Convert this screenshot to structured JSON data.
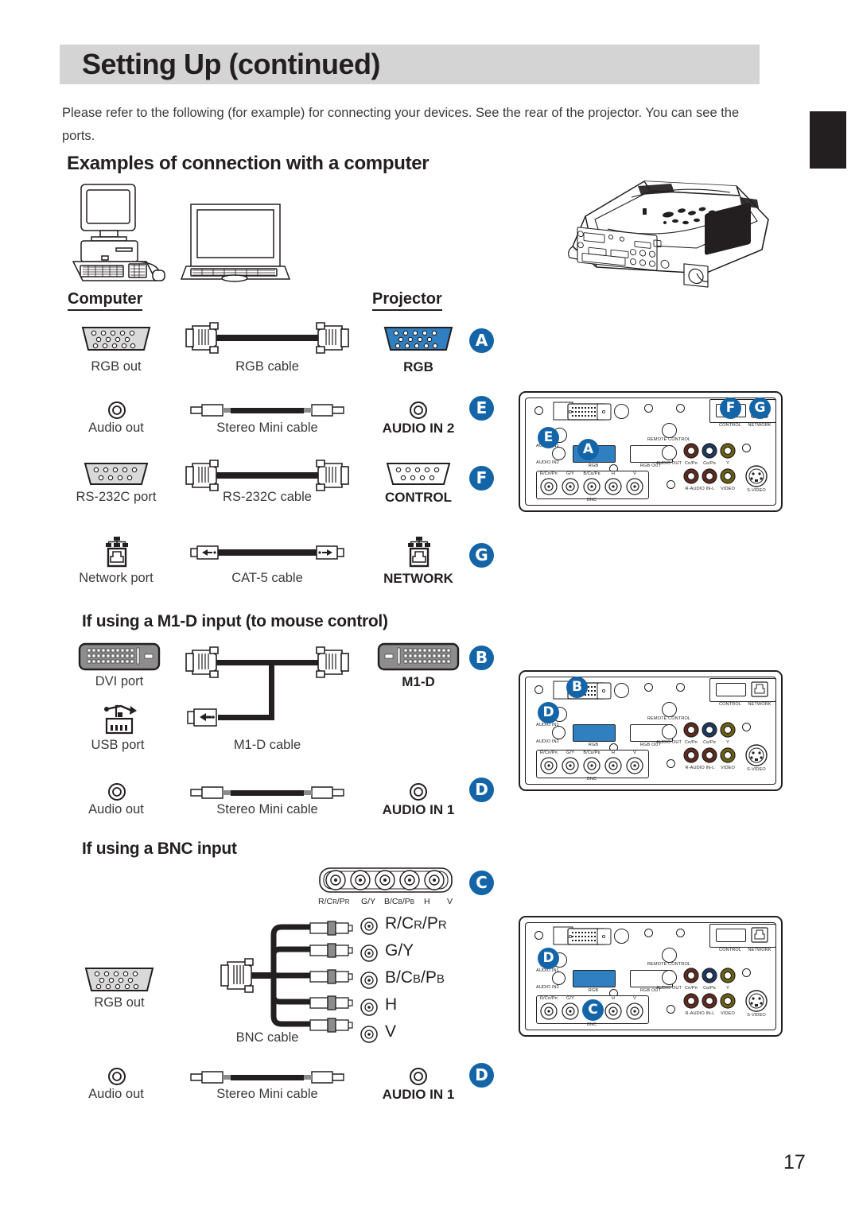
{
  "header": {
    "title": "Setting Up (continued)"
  },
  "intro": "Please refer to the following (for example) for connecting your devices. See the rear of the projector. You can see the ports.",
  "sections": {
    "examples_title": "Examples of connection with a computer",
    "m1d_title": "If using a M1-D input (to mouse control)",
    "bnc_title": "If using a BNC input"
  },
  "columns": {
    "computer": "Computer",
    "projector": "Projector"
  },
  "rows_main": [
    {
      "source": "RGB out",
      "cable": "RGB cable",
      "dest": "RGB",
      "badge": "A"
    },
    {
      "source": "Audio out",
      "cable": "Stereo Mini cable",
      "dest": "AUDIO IN 2",
      "badge": "E"
    },
    {
      "source": "RS-232C port",
      "cable": "RS-232C cable",
      "dest": "CONTROL",
      "badge": "F"
    },
    {
      "source": "Network port",
      "cable": "CAT-5 cable",
      "dest": "NETWORK",
      "badge": "G"
    }
  ],
  "rows_m1d": [
    {
      "source": "DVI port",
      "source2": "USB port",
      "cable": "M1-D cable",
      "dest": "M1-D",
      "badge": "B"
    },
    {
      "source": "Audio out",
      "cable": "Stereo Mini cable",
      "dest": "AUDIO IN 1",
      "badge": "D"
    }
  ],
  "rows_bnc": [
    {
      "source": "RGB out",
      "cable": "BNC cable",
      "badge": "C"
    },
    {
      "source": "Audio out",
      "cable": "Stereo Mini cable",
      "dest": "AUDIO IN 1",
      "badge": "D"
    }
  ],
  "bnc_block_labels": [
    "R/C",
    "G/Y",
    "B/C",
    "H",
    "V"
  ],
  "bnc_signals": [
    {
      "label": "R/CR/PR"
    },
    {
      "label": "G/Y"
    },
    {
      "label": "B/CB/PB"
    },
    {
      "label": "H"
    },
    {
      "label": "V"
    }
  ],
  "rear_panel": {
    "labels": {
      "audio_in1": "AUDIO IN1",
      "audio_in2": "AUDIO IN2",
      "rgb": "RGB",
      "rgb_out": "RGB OUT",
      "remote_control": "REMOTE CONTROL",
      "audio_out": "AUDIO OUT",
      "control": "CONTROL",
      "network": "NETWORK",
      "crpr": "CR/PR",
      "cbpb": "CB/PB",
      "y": "Y",
      "r_audio_in_l": "R-AUDIO IN-L",
      "video": "VIDEO",
      "s_video": "S-VIDEO",
      "bnc": "BNC",
      "bnc_row": [
        "R/CR/PR",
        "G/Y",
        "B/CB/PB",
        "H",
        "V"
      ]
    },
    "panel1_badges": [
      "E",
      "A",
      "F",
      "G"
    ],
    "panel2_badges": [
      "D",
      "B"
    ],
    "panel3_badges": [
      "D",
      "C"
    ]
  },
  "page_number": "17",
  "colors": {
    "badge": "#1465a8",
    "header_bar": "#d4d4d4",
    "port_highlight": "#2f7fc1"
  }
}
